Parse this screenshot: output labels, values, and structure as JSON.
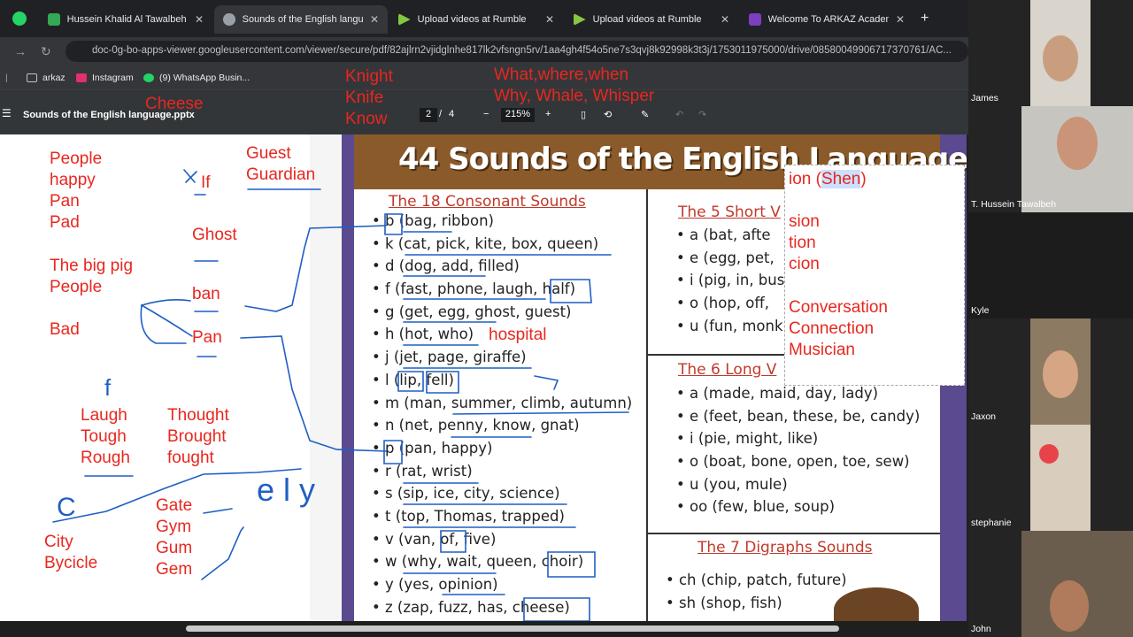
{
  "browser": {
    "tabs": [
      {
        "title": "Hussein Khalid Al Tawalbeh - G",
        "fav": "#34a853"
      },
      {
        "title": "Sounds of the English language",
        "fav": "#9aa0a6"
      },
      {
        "title": "Upload videos at Rumble",
        "fav": "#85c742"
      },
      {
        "title": "Upload videos at Rumble",
        "fav": "#85c742"
      },
      {
        "title": "Welcome To ARKAZ Academy",
        "fav": "#7b3fbf"
      }
    ],
    "url": "doc-0g-bo-apps-viewer.googleusercontent.com/viewer/secure/pdf/82ajlrn2vjidglnhe817lk2vfsngn5rv/1aa4gh4f54o5ne7s3qvj8k92998k3t3j/1753011975000/drive/08580049906717370761/AC...",
    "bookmarks": [
      "arkaz",
      "Instagram",
      "(9) WhatsApp Busin..."
    ]
  },
  "pdf": {
    "title": "Sounds of the English language.pptx",
    "page": "2",
    "total": "4",
    "zoom": "215%"
  },
  "annotations_top": {
    "cheese": "Cheese",
    "knight": "Knight\nKnife\nKnow",
    "wh": "What,where,when\nWhy, Whale, Whisper"
  },
  "whiteboard": {
    "col1": "People\nhappy\nPan\nPad",
    "pig": "The big pig\nPeople",
    "bad": "Bad",
    "if": "If",
    "guest": "Guest\nGuardian",
    "ghost": "Ghost",
    "ban": "ban",
    "pan": "Pan",
    "f": "f",
    "laugh": "Laugh\nTough\nRough",
    "thought": "Thought\nBrought\nfought",
    "gate": "Gate\nGym\nGum\nGem",
    "city": "City\nBycicle",
    "c": "C",
    "ely": "e l y"
  },
  "slide": {
    "title": "44 Sounds of the English Language",
    "consonant_head": "The 18 Consonant Sounds",
    "consonants": [
      "b (bag, ribbon)",
      "k (cat, pick, kite, box, queen)",
      "d (dog, add, filled)",
      "f (fast, phone, laugh, half)",
      "g (get, egg, ghost, guest)",
      "h (hot, who)",
      "j (jet, page, giraffe)",
      "l (lip, fell)",
      "m (man, summer, climb, autumn)",
      "n (net, penny, know, gnat)",
      "p (pan, happy)",
      "r (rat, wrist)",
      "s (sip, ice, city, science)",
      "t (top, Thomas, trapped)",
      "v (van, of, five)",
      "w (why, wait, queen, choir)",
      "y (yes, opinion)",
      "z (zap, fuzz, has, cheese)"
    ],
    "hospital": "hospital",
    "short_head": "The 5 Short V",
    "short": [
      "a (bat, afte",
      "e (egg, pet,",
      "i (pig, in, bus",
      "o (hop, off,",
      "u (fun, monk"
    ],
    "long_head": "The 6 Long V",
    "long": [
      "a (made, maid, day, lady)",
      "e (feet, bean, these, be, candy)",
      "i (pie, might, like)",
      "o (boat, bone, open, toe, sew)",
      "u (you, mule)",
      "oo (few, blue, soup)"
    ],
    "digraph_head": "The 7 Digraphs Sounds",
    "digraphs": [
      "ch (chip, patch, future)",
      "sh (shop, fish)"
    ]
  },
  "popup": {
    "line1a": "ion (",
    "line1b": "Shen",
    "line1c": ")",
    "sion": "sion\ntion\ncion",
    "words": "Conversation\nConnection\nMusician"
  },
  "participants": [
    "James",
    "T. Hussein Tawalbeh",
    "Kyle",
    "Jaxon",
    "stephanie",
    "John"
  ]
}
